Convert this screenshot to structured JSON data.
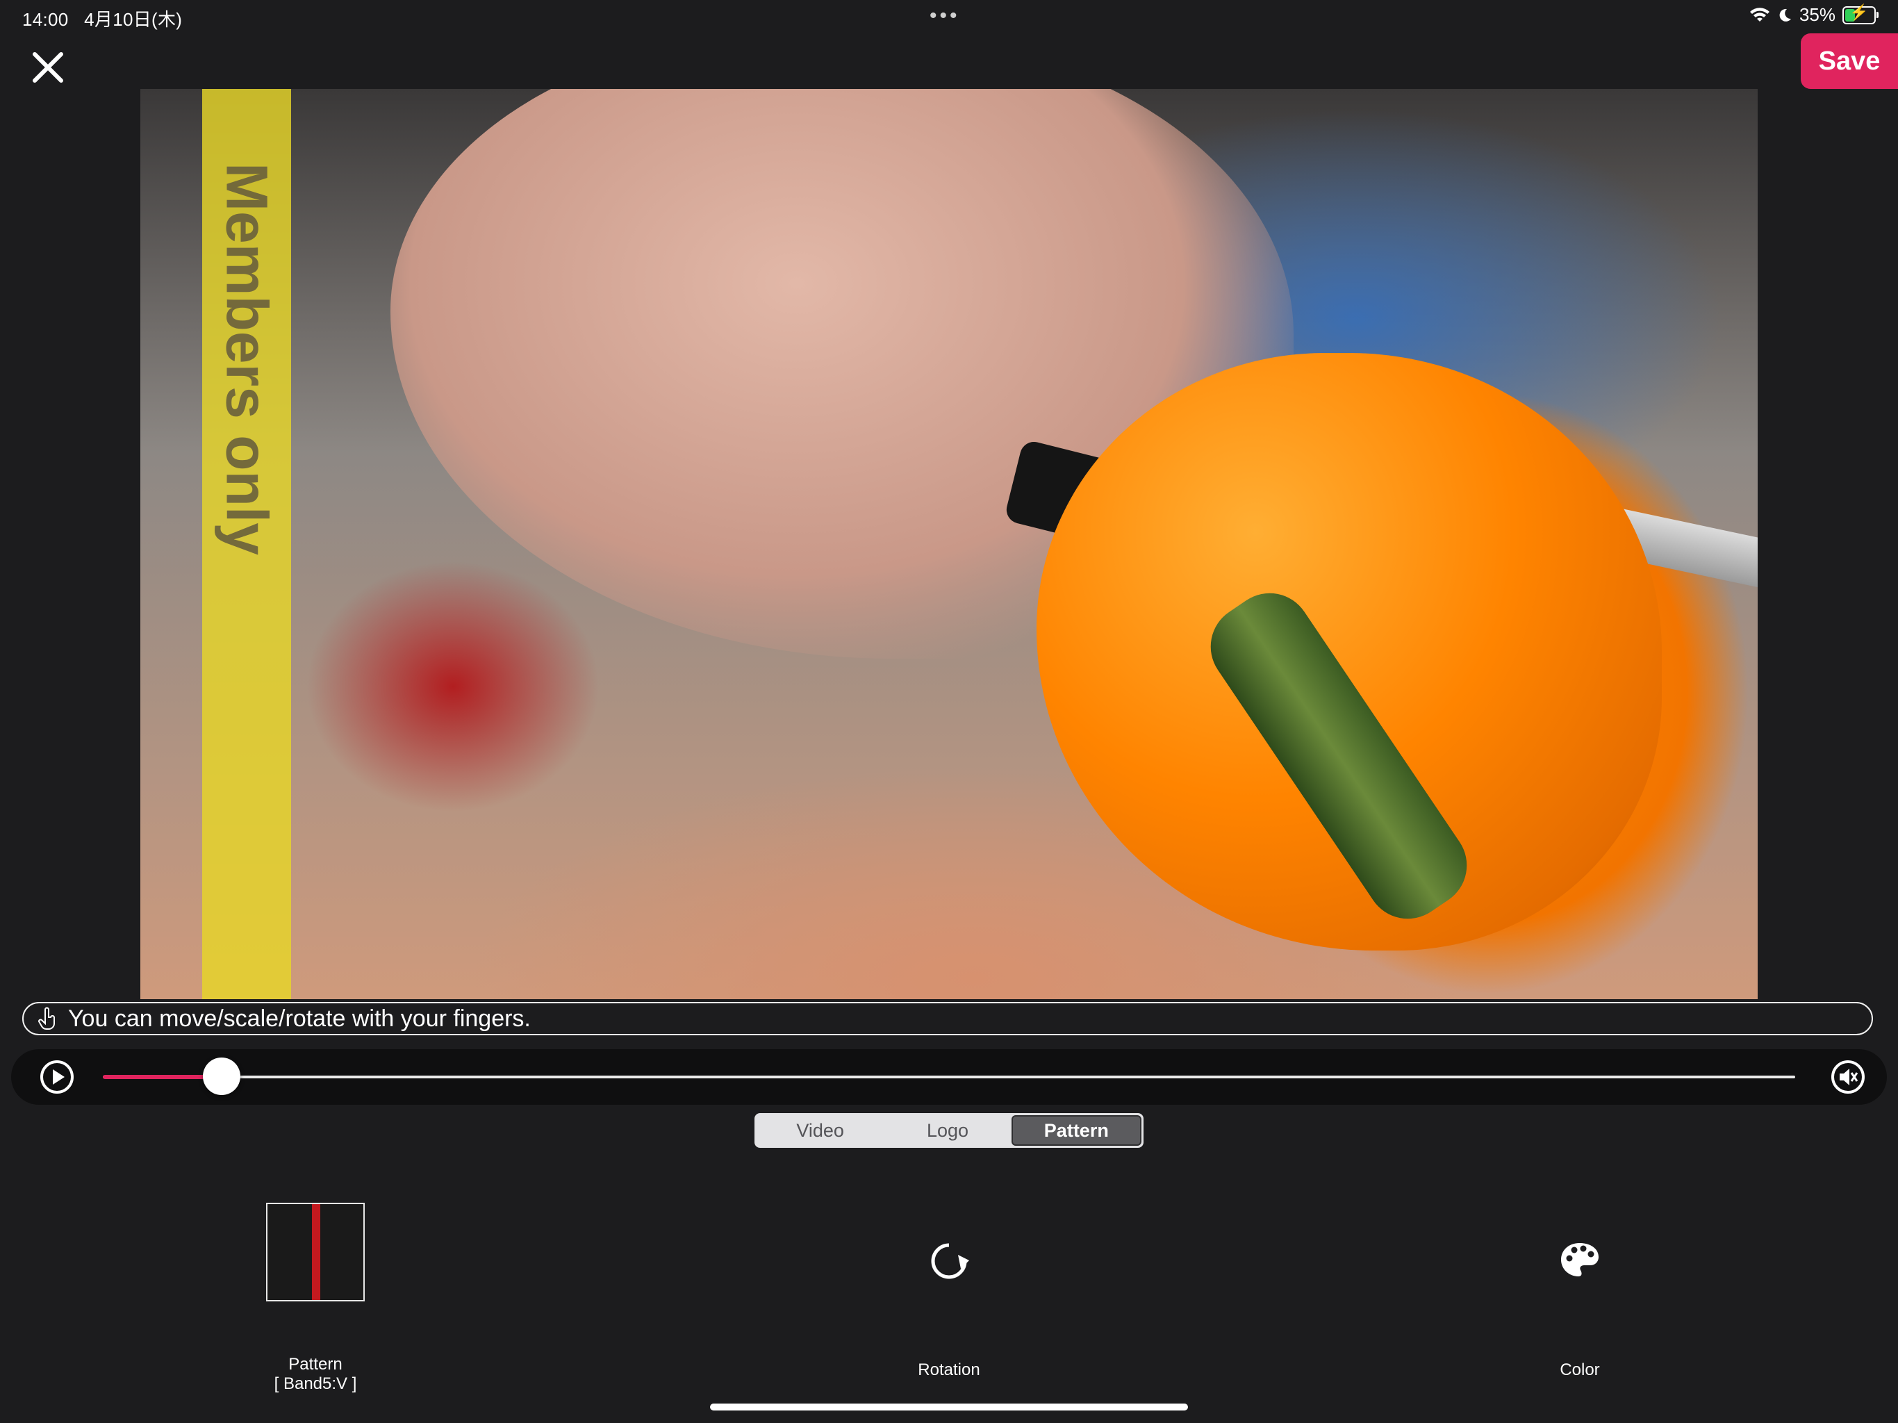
{
  "status_bar": {
    "time": "14:00",
    "date": "4月10日(木)",
    "dots": "•••",
    "battery_percent": "35%",
    "battery_level": 0.35,
    "icons": [
      "wifi-icon",
      "moon-icon",
      "battery-charging-icon"
    ]
  },
  "toolbar": {
    "close_icon": "close-icon",
    "save_label": "Save"
  },
  "preview": {
    "pattern_text": "Members only",
    "pattern_color": "#e6d628"
  },
  "hint": {
    "icon": "hand-pointer-icon",
    "text": "You can move/scale/rotate with your fingers."
  },
  "player": {
    "play_icon": "play-icon",
    "mute_icon": "mute-icon",
    "progress": 0.07,
    "accent_color": "#e0245e"
  },
  "segments": [
    {
      "label": "Video",
      "active": false
    },
    {
      "label": "Logo",
      "active": false
    },
    {
      "label": "Pattern",
      "active": true
    }
  ],
  "tools": {
    "pattern": {
      "label": "Pattern",
      "value": "[ Band5:V ]"
    },
    "rotation": {
      "label": "Rotation",
      "icon": "rotate-icon"
    },
    "color": {
      "label": "Color",
      "icon": "palette-icon"
    }
  }
}
